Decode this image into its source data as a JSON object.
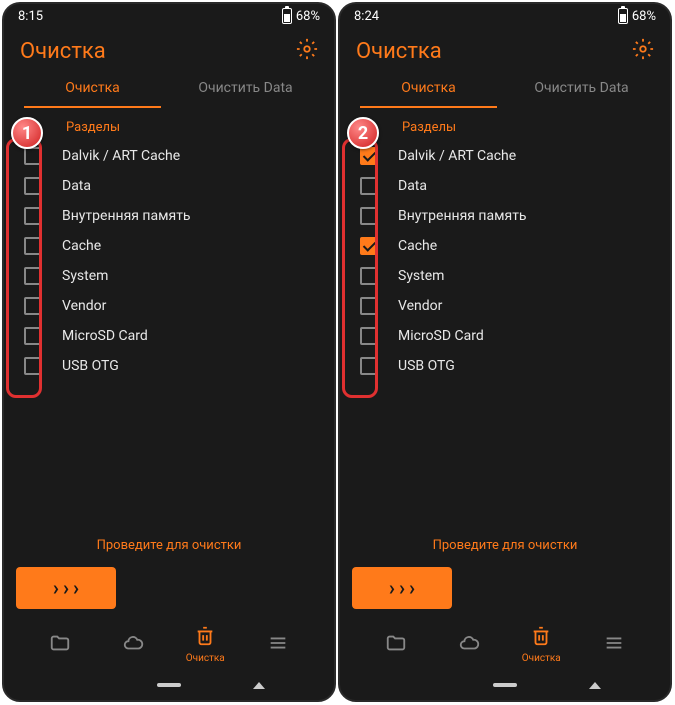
{
  "screens": [
    {
      "badge": "1",
      "status": {
        "time": "8:15",
        "battery": "68%"
      },
      "header": {
        "title": "Очистка"
      },
      "tabs": {
        "clean": "Очистка",
        "clear_data": "Очистить Data"
      },
      "section_label": "Разделы",
      "items": [
        {
          "label": "Dalvik / ART Cache",
          "checked": false
        },
        {
          "label": "Data",
          "checked": false
        },
        {
          "label": "Внутренняя память",
          "checked": false
        },
        {
          "label": "Cache",
          "checked": false
        },
        {
          "label": "System",
          "checked": false
        },
        {
          "label": "Vendor",
          "checked": false
        },
        {
          "label": "MicroSD Card",
          "checked": false
        },
        {
          "label": "USB OTG",
          "checked": false
        }
      ],
      "swipe_label": "Проведите для очистки",
      "nav_clean_label": "Очистка"
    },
    {
      "badge": "2",
      "status": {
        "time": "8:24",
        "battery": "68%"
      },
      "header": {
        "title": "Очистка"
      },
      "tabs": {
        "clean": "Очистка",
        "clear_data": "Очистить Data"
      },
      "section_label": "Разделы",
      "items": [
        {
          "label": "Dalvik / ART Cache",
          "checked": true
        },
        {
          "label": "Data",
          "checked": false
        },
        {
          "label": "Внутренняя память",
          "checked": false
        },
        {
          "label": "Cache",
          "checked": true
        },
        {
          "label": "System",
          "checked": false
        },
        {
          "label": "Vendor",
          "checked": false
        },
        {
          "label": "MicroSD Card",
          "checked": false
        },
        {
          "label": "USB OTG",
          "checked": false
        }
      ],
      "swipe_label": "Проведите для очистки",
      "nav_clean_label": "Очистка"
    }
  ]
}
